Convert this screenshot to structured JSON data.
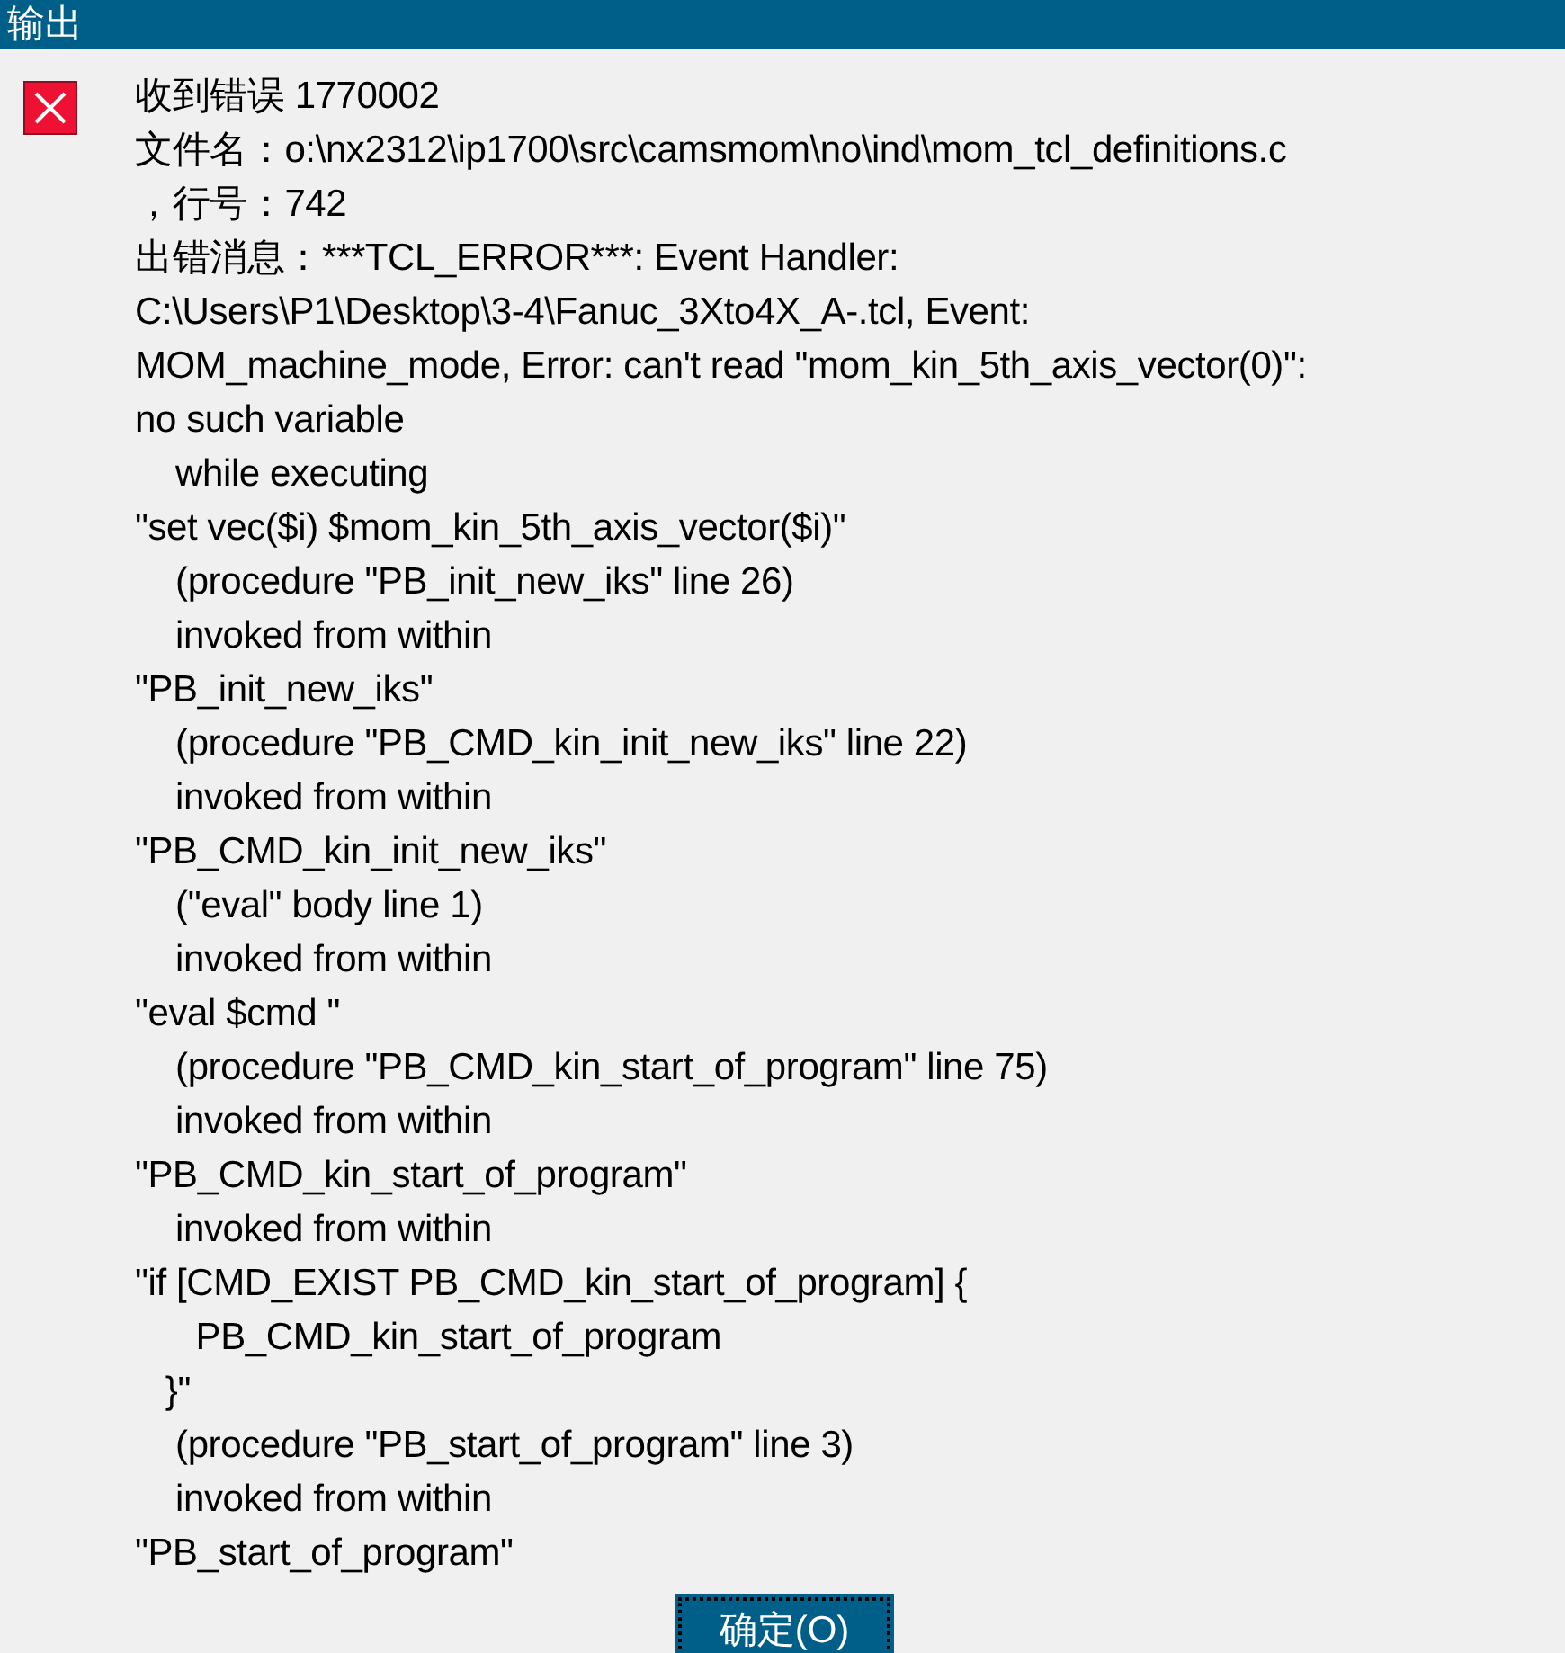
{
  "window": {
    "title": "输出"
  },
  "message": {
    "kind": "error",
    "lines": [
      "收到错误 1770002",
      "文件名：o:\\nx2312\\ip1700\\src\\camsmom\\no\\ind\\mom_tcl_definitions.c",
      "，行号：742",
      "出错消息：***TCL_ERROR***: Event Handler:",
      "C:\\Users\\P1\\Desktop\\3-4\\Fanuc_3Xto4X_A-.tcl, Event:",
      "MOM_machine_mode, Error: can't read \"mom_kin_5th_axis_vector(0)\":",
      "no such variable",
      "    while executing",
      "\"set vec($i) $mom_kin_5th_axis_vector($i)\"",
      "    (procedure \"PB_init_new_iks\" line 26)",
      "    invoked from within",
      "\"PB_init_new_iks\"",
      "    (procedure \"PB_CMD_kin_init_new_iks\" line 22)",
      "    invoked from within",
      "\"PB_CMD_kin_init_new_iks\"",
      "    (\"eval\" body line 1)",
      "    invoked from within",
      "\"eval $cmd \"",
      "    (procedure \"PB_CMD_kin_start_of_program\" line 75)",
      "    invoked from within",
      "\"PB_CMD_kin_start_of_program\"",
      "    invoked from within",
      "\"if [CMD_EXIST PB_CMD_kin_start_of_program] {",
      "      PB_CMD_kin_start_of_program",
      "   }\"",
      "    (procedure \"PB_start_of_program\" line 3)",
      "    invoked from within",
      "\"PB_start_of_program\""
    ]
  },
  "buttons": [
    {
      "label": "确定(O)",
      "focused": true
    }
  ]
}
